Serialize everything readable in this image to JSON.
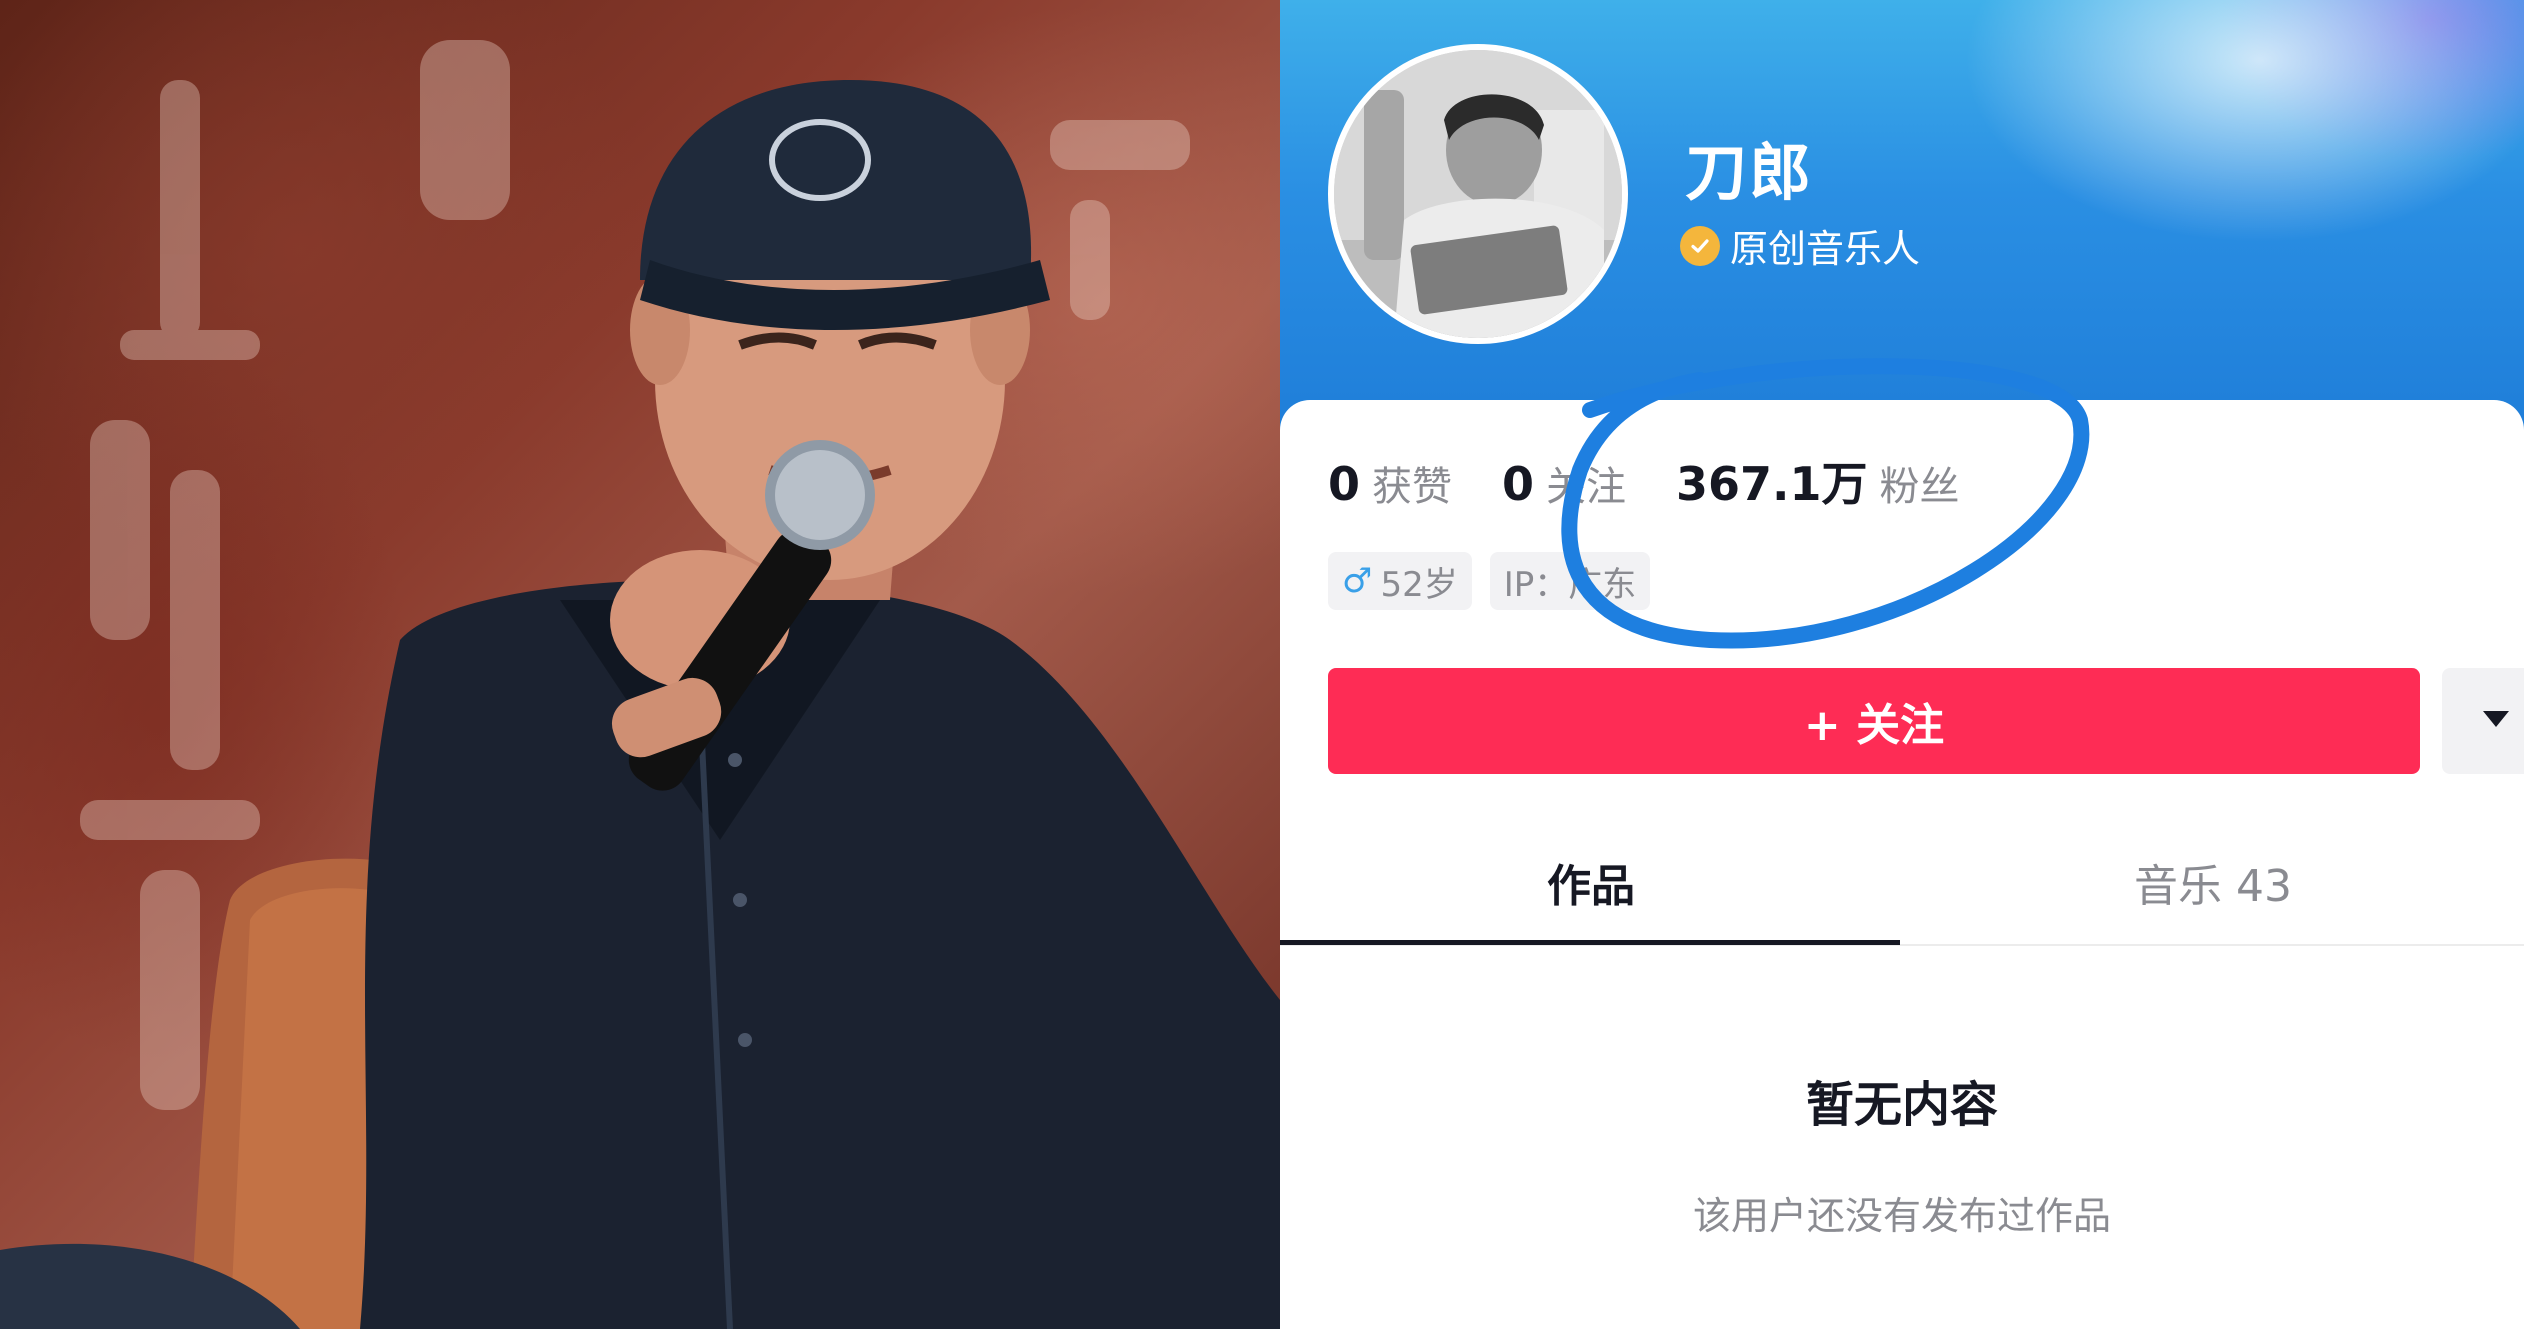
{
  "profile": {
    "name": "刀郎",
    "verified_label": "原创音乐人",
    "stats": [
      {
        "value": "0",
        "label": "获赞"
      },
      {
        "value": "0",
        "label": "关注"
      },
      {
        "value": "367.1万",
        "label": "粉丝"
      }
    ],
    "tags": {
      "age": "52岁",
      "ip": "IP：广东"
    },
    "follow_button": "+ 关注",
    "tabs": {
      "works": "作品",
      "music": "音乐 43"
    },
    "empty": {
      "title": "暂无内容",
      "subtitle": "该用户还没有发布过作品"
    }
  },
  "colors": {
    "follow": "#fe2c55",
    "annotation": "#1e7fe0",
    "verified": "#f4b63c"
  },
  "icons": {
    "verified": "check-badge-icon",
    "gender": "male-icon",
    "more": "caret-down-icon"
  }
}
